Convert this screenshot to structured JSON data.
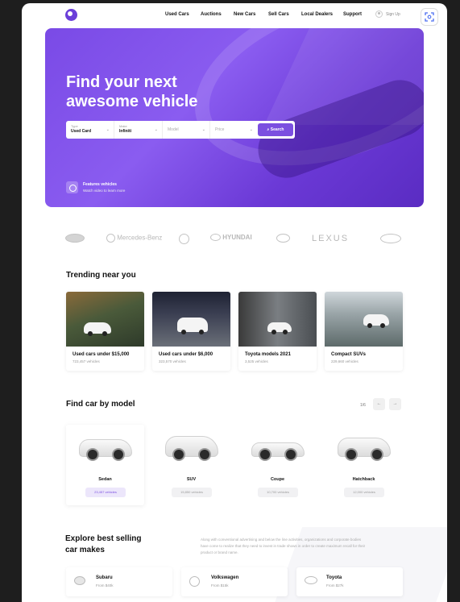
{
  "nav": {
    "links": [
      "Used Cars",
      "Auctions",
      "New Cars",
      "Sell Cars",
      "Local Dealers",
      "Support"
    ],
    "signup": "Sign Up"
  },
  "hero": {
    "title_line1": "Find your next",
    "title_line2": "awesome vehicle",
    "search": {
      "type_label": "Type",
      "type_value": "Used Card",
      "make_label": "Make",
      "make_value": "Infiniti",
      "model_placeholder": "Model",
      "price_placeholder": "Price",
      "button": "Search"
    },
    "featured_title": "Features vehicles",
    "featured_sub": "Watch video to learn more"
  },
  "brands": [
    "Subaru",
    "Mercedes-Benz",
    "Volkswagen",
    "HYUNDAI",
    "Toyota",
    "LEXUS",
    "Infiniti"
  ],
  "trending": {
    "title": "Trending near you",
    "cards": [
      {
        "title": "Used cars under $15,000",
        "sub": "723,457 vehicles",
        "bg": "#4a5a3a"
      },
      {
        "title": "Used cars under $6,000",
        "sub": "323,570 vehicles",
        "bg": "#3b3f52"
      },
      {
        "title": "Toyota models 2021",
        "sub": "3,525 vehicles",
        "bg": "#5a5e62"
      },
      {
        "title": "Compact SUVs",
        "sub": "229,660 vehicles",
        "bg": "#7d8a8e"
      }
    ]
  },
  "models": {
    "title": "Find car by model",
    "pager": "1/6",
    "cards": [
      {
        "name": "Sedan",
        "count": "23,457 vehicles"
      },
      {
        "name": "SUV",
        "count": "15,850 vehicles"
      },
      {
        "name": "Coupe",
        "count": "10,700 vehicles"
      },
      {
        "name": "Hatchback",
        "count": "12,000 vehicles"
      }
    ]
  },
  "best": {
    "title_line1": "Explore best selling",
    "title_line2": "car makes",
    "desc": "Along with conventional advertising and below the line activities, organizations and corporate bodies have come to realize that they need to invest in trade shows in order to create maximum recall for their product or brand name.",
    "makes": [
      {
        "name": "Subaru",
        "price": "From $40k"
      },
      {
        "name": "Volkswagen",
        "price": "From $15k"
      },
      {
        "name": "Toyota",
        "price": "From $27k"
      }
    ]
  },
  "colors": {
    "accent": "#7b4fe0",
    "hero": "#8a5cf0"
  }
}
